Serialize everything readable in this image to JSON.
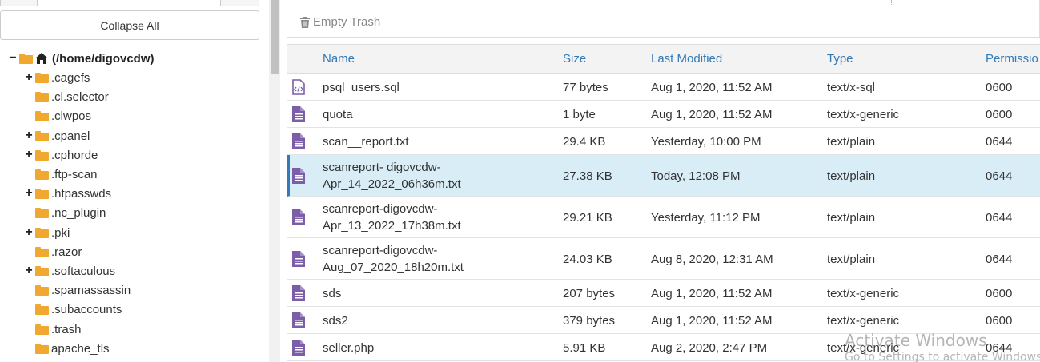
{
  "sidebar": {
    "collapse_label": "Collapse All",
    "root": {
      "label": "(/home/digovcdw)"
    },
    "items": [
      {
        "label": ".cagefs",
        "toggle": "+"
      },
      {
        "label": ".cl.selector",
        "toggle": ""
      },
      {
        "label": ".clwpos",
        "toggle": ""
      },
      {
        "label": ".cpanel",
        "toggle": "+"
      },
      {
        "label": ".cphorde",
        "toggle": "+"
      },
      {
        "label": ".ftp-scan",
        "toggle": ""
      },
      {
        "label": ".htpasswds",
        "toggle": "+"
      },
      {
        "label": ".nc_plugin",
        "toggle": ""
      },
      {
        "label": ".pki",
        "toggle": "+"
      },
      {
        "label": ".razor",
        "toggle": ""
      },
      {
        "label": ".softaculous",
        "toggle": "+"
      },
      {
        "label": ".spamassassin",
        "toggle": ""
      },
      {
        "label": ".subaccounts",
        "toggle": ""
      },
      {
        "label": ".trash",
        "toggle": ""
      },
      {
        "label": "apache_tls",
        "toggle": ""
      }
    ]
  },
  "toolbar": {
    "empty_trash_label": "Empty Trash"
  },
  "table": {
    "headers": {
      "name": "Name",
      "size": "Size",
      "modified": "Last Modified",
      "type": "Type",
      "perms": "Permissio"
    },
    "rows": [
      {
        "name": "psql_users.sql",
        "name2": "",
        "size": "77 bytes",
        "modified": "Aug 1, 2020, 11:52 AM",
        "type": "text/x-sql",
        "perms": "0600",
        "icon": "code-file-icon",
        "selected": false
      },
      {
        "name": "quota",
        "name2": "",
        "size": "1 byte",
        "modified": "Aug 1, 2020, 11:52 AM",
        "type": "text/x-generic",
        "perms": "0600",
        "icon": "text-file-icon",
        "selected": false
      },
      {
        "name": "scan__report.txt",
        "name2": "",
        "size": "29.4 KB",
        "modified": "Yesterday, 10:00 PM",
        "type": "text/plain",
        "perms": "0644",
        "icon": "text-file-icon",
        "selected": false
      },
      {
        "name": "scanreport- digovcdw-",
        "name2": "Apr_14_2022_06h36m.txt",
        "size": "27.38 KB",
        "modified": "Today, 12:08 PM",
        "type": "text/plain",
        "perms": "0644",
        "icon": "text-file-icon",
        "selected": true
      },
      {
        "name": "scanreport-digovcdw-",
        "name2": "Apr_13_2022_17h38m.txt",
        "size": "29.21 KB",
        "modified": "Yesterday, 11:12 PM",
        "type": "text/plain",
        "perms": "0644",
        "icon": "text-file-icon",
        "selected": false
      },
      {
        "name": "scanreport-digovcdw-",
        "name2": "Aug_07_2020_18h20m.txt",
        "size": "24.03 KB",
        "modified": "Aug 8, 2020, 12:31 AM",
        "type": "text/plain",
        "perms": "0644",
        "icon": "text-file-icon",
        "selected": false
      },
      {
        "name": "sds",
        "name2": "",
        "size": "207 bytes",
        "modified": "Aug 1, 2020, 11:52 AM",
        "type": "text/x-generic",
        "perms": "0600",
        "icon": "text-file-icon",
        "selected": false
      },
      {
        "name": "sds2",
        "name2": "",
        "size": "379 bytes",
        "modified": "Aug 1, 2020, 11:52 AM",
        "type": "text/x-generic",
        "perms": "0600",
        "icon": "text-file-icon",
        "selected": false
      },
      {
        "name": "seller.php",
        "name2": "",
        "size": "5.91 KB",
        "modified": "Aug 2, 2020, 2:47 PM",
        "type": "text/x-generic",
        "perms": "0644",
        "icon": "text-file-icon",
        "selected": false
      }
    ]
  },
  "watermark": {
    "line1": "Activate Windows",
    "line2": "Go to Settings to activate Windows."
  },
  "colors": {
    "link": "#337ab7",
    "folder": "#f0a830",
    "file_icon": "#7b5ea7",
    "selected_row": "#d9edf7"
  }
}
